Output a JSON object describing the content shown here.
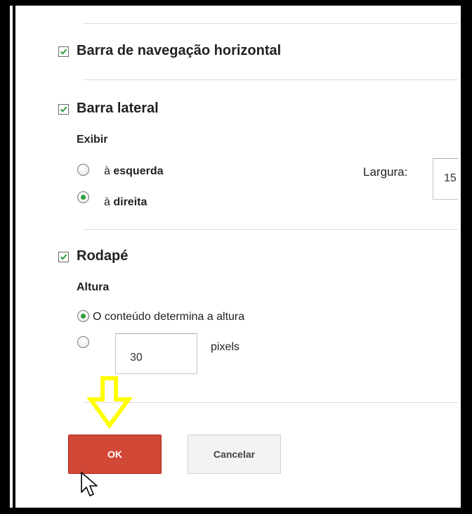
{
  "sections": {
    "nav_bar": {
      "label": "Barra de navegação horizontal",
      "checked": true
    },
    "sidebar": {
      "label": "Barra lateral",
      "checked": true,
      "show_label": "Exibir",
      "options": [
        {
          "prefix": "à",
          "bold": "esquerda",
          "selected": false
        },
        {
          "prefix": "à",
          "bold": "direita",
          "selected": true
        }
      ],
      "width_label": "Largura:",
      "width_value": "15"
    },
    "footer": {
      "label": "Rodapé",
      "checked": true,
      "height_label": "Altura",
      "auto_option": "O conteúdo determina a altura",
      "auto_selected": true,
      "custom_value": "30",
      "custom_unit": "pixels",
      "custom_selected": false
    }
  },
  "buttons": {
    "ok": "OK",
    "cancel": "Cancelar"
  },
  "colors": {
    "ok_button": "#d14836",
    "annotation_arrow": "#ffff00",
    "checkmark": "#2e9e3a"
  },
  "icons": [
    "checkbox-checked-icon",
    "radio-icon",
    "down-arrow-annotation-icon",
    "mouse-pointer-icon"
  ]
}
